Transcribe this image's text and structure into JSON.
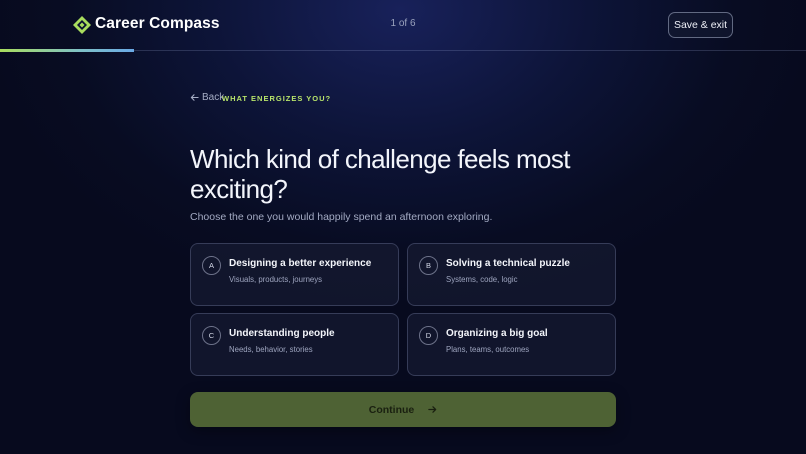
{
  "header": {
    "brand": "Career Compass",
    "step_indicator": "1 of 6",
    "save_label": "Save & exit",
    "progress_fraction": 0.1667,
    "accent_color": "#a9dd5e"
  },
  "question": {
    "back_label": "Back",
    "eyebrow": "WHAT ENERGIZES YOU?",
    "title": "Which kind of challenge feels most exciting?",
    "subtitle": "Choose the one you would happily spend an afternoon exploring."
  },
  "options": [
    {
      "letter": "A",
      "title": "Designing a better experience",
      "subtitle": "Visuals, products, journeys"
    },
    {
      "letter": "B",
      "title": "Solving a technical puzzle",
      "subtitle": "Systems, code, logic"
    },
    {
      "letter": "C",
      "title": "Understanding people",
      "subtitle": "Needs, behavior, stories"
    },
    {
      "letter": "D",
      "title": "Organizing a big goal",
      "subtitle": "Plans, teams, outcomes"
    }
  ],
  "footer": {
    "continue_label": "Continue"
  }
}
